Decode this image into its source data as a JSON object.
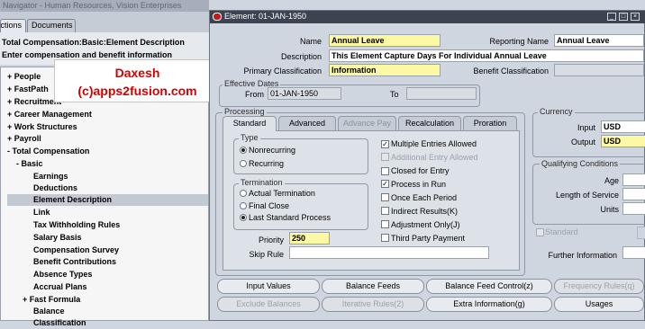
{
  "navigator": {
    "title": "Navigator - Human Resources, Vision Enterprises",
    "tabs": [
      "Functions",
      "Documents"
    ],
    "path_line1": "Total Compensation:Basic:Element Description",
    "path_line2": "Enter compensation and benefit information",
    "tree": [
      {
        "prefix": "+",
        "label": "People"
      },
      {
        "prefix": "+",
        "label": "FastPath"
      },
      {
        "prefix": "+",
        "label": "Recruitment"
      },
      {
        "prefix": "+",
        "label": "Career Management"
      },
      {
        "prefix": "+",
        "label": "Work Structures"
      },
      {
        "prefix": "+",
        "label": "Payroll"
      },
      {
        "prefix": "-",
        "label": "Total Compensation"
      },
      {
        "prefix": "-",
        "label": "Basic"
      },
      {
        "prefix": "",
        "label": "Earnings"
      },
      {
        "prefix": "",
        "label": "Deductions"
      },
      {
        "prefix": "",
        "label": "Element Description"
      },
      {
        "prefix": "",
        "label": "Link"
      },
      {
        "prefix": "",
        "label": "Tax Withholding Rules"
      },
      {
        "prefix": "",
        "label": "Salary Basis"
      },
      {
        "prefix": "",
        "label": "Compensation Survey"
      },
      {
        "prefix": "",
        "label": "Benefit Contributions"
      },
      {
        "prefix": "",
        "label": "Absence Types"
      },
      {
        "prefix": "",
        "label": "Accrual Plans"
      },
      {
        "prefix": "+",
        "label": "Fast Formula"
      },
      {
        "prefix": "",
        "label": "Balance"
      },
      {
        "prefix": "",
        "label": "Classification"
      }
    ]
  },
  "watermark": {
    "line1": "Daxesh",
    "line2": "(c)apps2fusion.com"
  },
  "window": {
    "title": "Element: 01-JAN-1950",
    "name_label": "Name",
    "name_value": "Annual Leave",
    "reporting_name_label": "Reporting Name",
    "reporting_name_value": "Annual Leave",
    "description_label": "Description",
    "description_value": "This Element Capture Days For Individual Annual Leave",
    "primary_class_label": "Primary Classification",
    "primary_class_value": "Information",
    "benefit_class_label": "Benefit Classification",
    "effective_dates_title": "Effective Dates",
    "from_label": "From",
    "from_value": "01-JAN-1950",
    "to_label": "To",
    "processing_title": "Processing",
    "tabs": [
      "Standard",
      "Advanced",
      "Advance Pay",
      "Recalculation",
      "Proration"
    ],
    "type_title": "Type",
    "type_options": [
      "Nonrecurring",
      "Recurring"
    ],
    "termination_title": "Termination",
    "termination_options": [
      "Actual Termination",
      "Final Close",
      "Last Standard Process"
    ],
    "checkboxes": [
      {
        "label": "Multiple Entries Allowed",
        "checked": true,
        "enabled": true
      },
      {
        "label": "Additional Entry Allowed",
        "checked": false,
        "enabled": false
      },
      {
        "label": "Closed for Entry",
        "checked": false,
        "enabled": true
      },
      {
        "label": "Process in Run",
        "checked": true,
        "enabled": true
      },
      {
        "label": "Once Each Period",
        "checked": false,
        "enabled": true
      },
      {
        "label": "Indirect Results(K)",
        "checked": false,
        "enabled": true
      },
      {
        "label": "Adjustment Only(J)",
        "checked": false,
        "enabled": true
      },
      {
        "label": "Third Party Payment",
        "checked": false,
        "enabled": true
      }
    ],
    "priority_label": "Priority",
    "priority_value": "250",
    "skip_rule_label": "Skip Rule",
    "currency_title": "Currency",
    "input_label": "Input",
    "input_value": "USD",
    "output_label": "Output",
    "output_value": "USD",
    "qualifying_title": "Qualifying Conditions",
    "age_label": "Age",
    "length_service_label": "Length of Service",
    "units_label": "Units",
    "standard_label": "Standard",
    "further_info_label": "Further Information",
    "buttons_row1": [
      "Input Values",
      "Balance Feeds",
      "Balance Feed Control(z)",
      "Frequency Rules(q)"
    ],
    "buttons_row2": [
      "Exclude Balances",
      "Iterative Rules(2)",
      "Extra Information(g)",
      "Usages"
    ]
  }
}
